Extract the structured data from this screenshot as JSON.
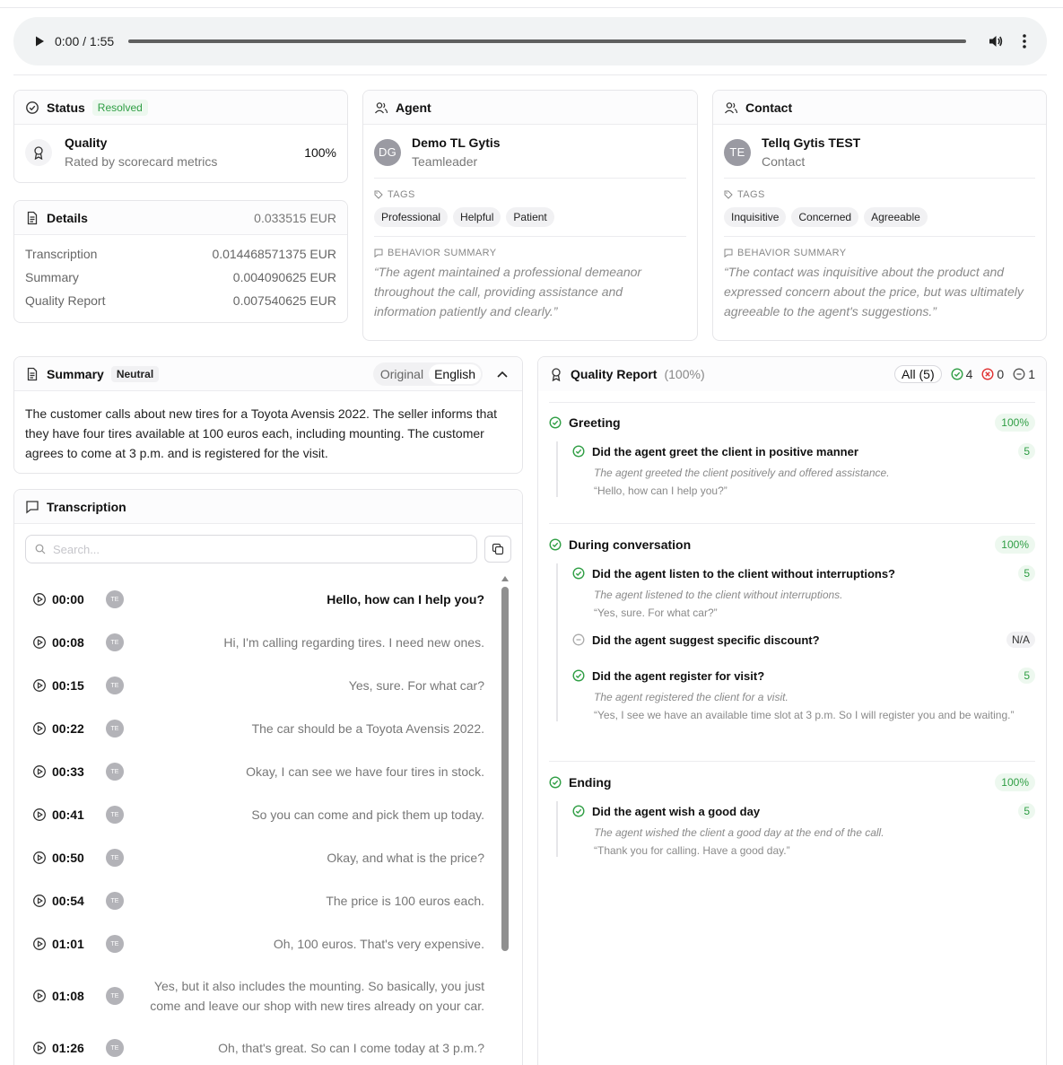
{
  "player": {
    "time": "0:00 / 1:55"
  },
  "status": {
    "title": "Status",
    "badge": "Resolved",
    "quality_label": "Quality",
    "quality_sub": "Rated by scorecard metrics",
    "quality_value": "100%"
  },
  "details": {
    "title": "Details",
    "total": "0.033515 EUR",
    "rows": [
      {
        "label": "Transcription",
        "value": "0.014468571375 EUR"
      },
      {
        "label": "Summary",
        "value": "0.004090625 EUR"
      },
      {
        "label": "Quality Report",
        "value": "0.007540625 EUR"
      }
    ]
  },
  "agent": {
    "title": "Agent",
    "initials": "DG",
    "name": "Demo TL Gytis",
    "role": "Teamleader",
    "tags_label": "TAGS",
    "tags": [
      "Professional",
      "Helpful",
      "Patient"
    ],
    "behavior_label": "BEHAVIOR SUMMARY",
    "behavior": "“The agent maintained a professional demeanor throughout the call, providing assistance and information patiently and clearly.”"
  },
  "contact": {
    "title": "Contact",
    "initials": "TE",
    "name": "Tellq Gytis TEST",
    "role": "Contact",
    "tags_label": "TAGS",
    "tags": [
      "Inquisitive",
      "Concerned",
      "Agreeable"
    ],
    "behavior_label": "BEHAVIOR SUMMARY",
    "behavior": "“The contact was inquisitive about the product and expressed concern about the price, but was ultimately agreeable to the agent's suggestions.”"
  },
  "summary": {
    "title": "Summary",
    "badge": "Neutral",
    "seg_original": "Original",
    "seg_english": "English",
    "text": "The customer calls about new tires for a Toyota Avensis 2022. The seller informs that they have four tires available at 100 euros each, including mounting. The customer agrees to come at 3 p.m. and is registered for the visit."
  },
  "transcription": {
    "title": "Transcription",
    "search_placeholder": "Search...",
    "rows": [
      {
        "time": "00:00",
        "initials": "TE",
        "text": "Hello, how can I help you?"
      },
      {
        "time": "00:08",
        "initials": "TE",
        "text": "Hi, I'm calling regarding tires. I need new ones."
      },
      {
        "time": "00:15",
        "initials": "TE",
        "text": "Yes, sure. For what car?"
      },
      {
        "time": "00:22",
        "initials": "TE",
        "text": "The car should be a Toyota Avensis 2022."
      },
      {
        "time": "00:33",
        "initials": "TE",
        "text": "Okay, I can see we have four tires in stock."
      },
      {
        "time": "00:41",
        "initials": "TE",
        "text": "So you can come and pick them up today."
      },
      {
        "time": "00:50",
        "initials": "TE",
        "text": "Okay, and what is the price?"
      },
      {
        "time": "00:54",
        "initials": "TE",
        "text": "The price is 100 euros each."
      },
      {
        "time": "01:01",
        "initials": "TE",
        "text": "Oh, 100 euros. That's very expensive."
      },
      {
        "time": "01:08",
        "initials": "TE",
        "text": "Yes, but it also includes the mounting. So basically, you just come and leave our shop with new tires already on your car."
      },
      {
        "time": "01:26",
        "initials": "TE",
        "text": "Oh, that's great. So can I come today at 3 p.m.?"
      }
    ]
  },
  "quality_report": {
    "title": "Quality Report",
    "pct": "(100%)",
    "filter_all": "All (5)",
    "filter_pass": "4",
    "filter_fail": "0",
    "filter_na": "1",
    "sections": [
      {
        "title": "Greeting",
        "score": "100%",
        "items": [
          {
            "question": "Did the agent greet the client in positive manner",
            "score": "5",
            "desc": "The agent greeted the client positively and offered assistance.",
            "quote": "“Hello, how can I help you?”"
          }
        ]
      },
      {
        "title": "During conversation",
        "score": "100%",
        "items": [
          {
            "question": "Did the agent listen to the client without interruptions?",
            "score": "5",
            "desc": "The agent listened to the client without interruptions.",
            "quote": "“Yes, sure. For what car?”"
          },
          {
            "question": "Did the agent suggest specific discount?",
            "score": "N/A"
          },
          {
            "question": "Did the agent register for visit?",
            "score": "5",
            "desc": "The agent registered the client for a visit.",
            "quote": "“Yes, I see we have an available time slot at 3 p.m. So I will register you and be waiting.”"
          }
        ]
      },
      {
        "title": "Ending",
        "score": "100%",
        "items": [
          {
            "question": "Did the agent wish a good day",
            "score": "5",
            "desc": "The agent wished the client a good day at the end of the call.",
            "quote": "“Thank you for calling. Have a good day.”"
          }
        ]
      }
    ]
  },
  "colors": {
    "accent_green": "#2f9e44",
    "danger_red": "#e03131",
    "border": "#e6e6e9"
  }
}
